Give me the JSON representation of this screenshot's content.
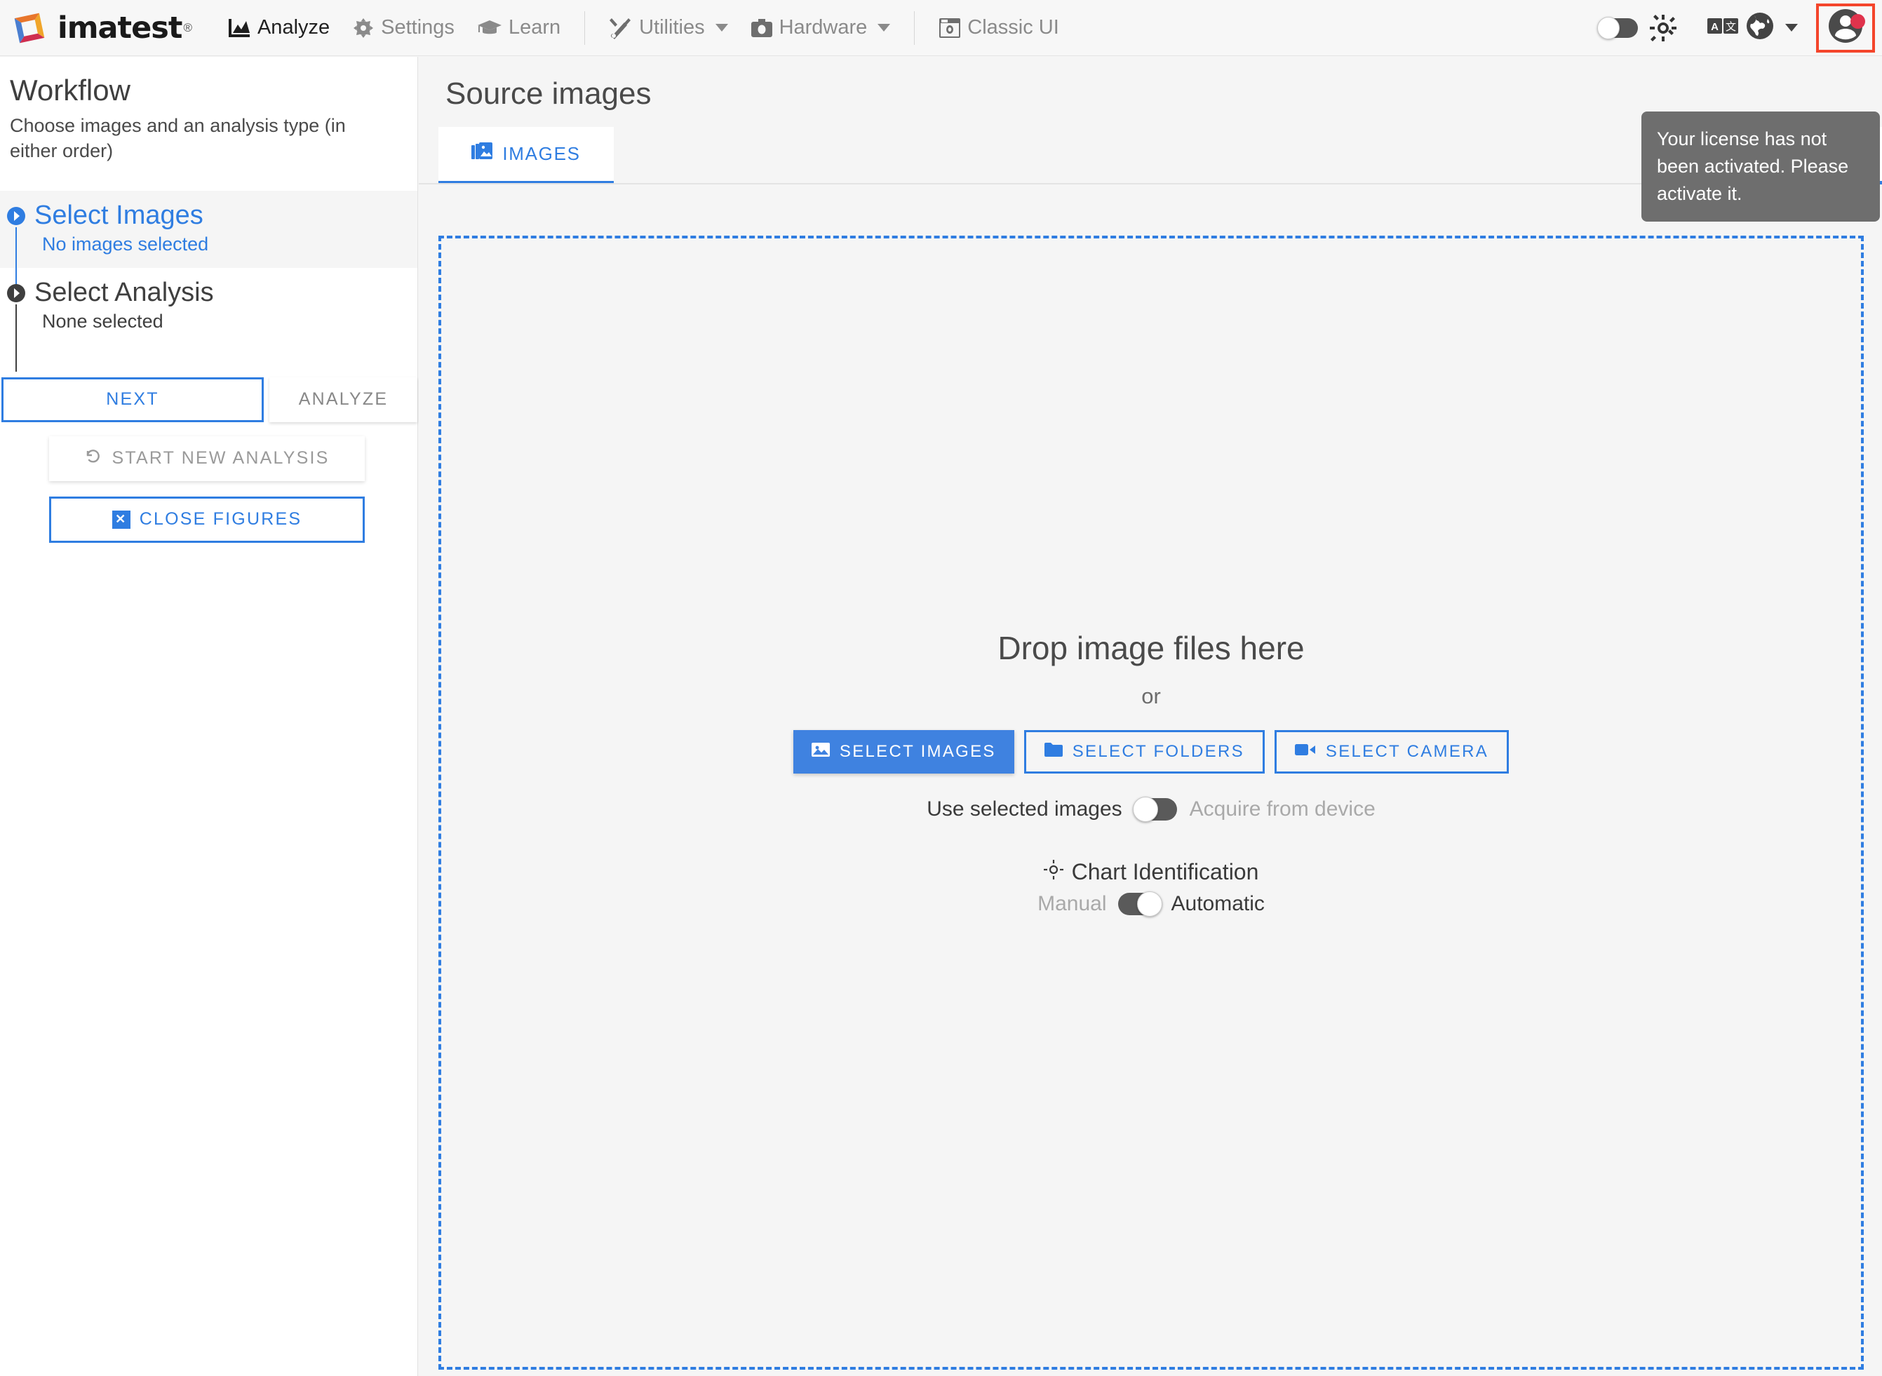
{
  "app": {
    "brand_name": "imatest",
    "brand_registered": "®"
  },
  "topnav": {
    "items": [
      {
        "label": "Analyze",
        "icon": "chart-mountain-icon",
        "active": true,
        "caret": false
      },
      {
        "label": "Settings",
        "icon": "gear-icon",
        "active": false,
        "caret": false
      },
      {
        "label": "Learn",
        "icon": "graduation-cap-icon",
        "active": false,
        "caret": false
      },
      {
        "label": "Utilities",
        "icon": "tools-icon",
        "active": false,
        "caret": true
      },
      {
        "label": "Hardware",
        "icon": "camera-icon",
        "active": false,
        "caret": true
      },
      {
        "label": "Classic UI",
        "icon": "classic-window-icon",
        "active": false,
        "caret": false
      }
    ],
    "right": {
      "theme_toggle": "dark-mode-toggle",
      "theme_icon": "sun-icon",
      "language_icon": "translate-icon",
      "globe_icon": "globe-icon",
      "language_caret": "chevron-down-icon",
      "account_icon": "account-avatar-icon",
      "notification_badge": true,
      "highlight_color": "#f4452b"
    }
  },
  "sidebar": {
    "title": "Workflow",
    "subtitle": "Choose images and an analysis type (in either order)",
    "steps": [
      {
        "title": "Select Images",
        "subtitle": "No images selected",
        "state": "active",
        "bullet": "chevron-right-circle-icon"
      },
      {
        "title": "Select Analysis",
        "subtitle": "None selected",
        "state": "inactive",
        "bullet": "chevron-right-circle-icon"
      }
    ],
    "buttons": {
      "next": "NEXT",
      "analyze": "ANALYZE",
      "start_new_analysis": "START NEW ANALYSIS",
      "close_figures": "CLOSE FIGURES"
    },
    "icons": {
      "start_new_analysis": "undo-arrow-icon",
      "close_figures": "close-square-icon"
    }
  },
  "main": {
    "title": "Source images",
    "tabs": [
      {
        "label": "IMAGES",
        "icon": "images-stack-icon",
        "active": true
      }
    ],
    "view_toggle": [
      {
        "name": "list-view",
        "icon": "list-view-icon",
        "active": false
      },
      {
        "name": "grid-view",
        "icon": "grid-view-icon",
        "active": true
      }
    ],
    "toast": {
      "message": "Your license has not been activated. Please activate it.",
      "background": "#6e6e6e"
    },
    "dropzone": {
      "title": "Drop image files here",
      "or": "or",
      "buttons": [
        {
          "label": "SELECT IMAGES",
          "icon": "image-icon",
          "style": "primary"
        },
        {
          "label": "SELECT FOLDERS",
          "icon": "folder-icon",
          "style": "outline"
        },
        {
          "label": "SELECT CAMERA",
          "icon": "video-camera-icon",
          "style": "outline"
        }
      ],
      "source_toggle": {
        "left_label": "Use selected images",
        "right_label": "Acquire from device",
        "selected": "left"
      },
      "chart_identification": {
        "title": "Chart Identification",
        "icon": "crosshair-icon",
        "left_label": "Manual",
        "right_label": "Automatic",
        "selected": "right"
      },
      "border_color": "#2f7de1"
    }
  },
  "colors": {
    "accent_blue": "#2f7de1",
    "primary_button": "#3f82e0",
    "text_dark": "#3f3f3f",
    "text_muted": "#8a8a8a",
    "badge_red": "#e0334c"
  }
}
